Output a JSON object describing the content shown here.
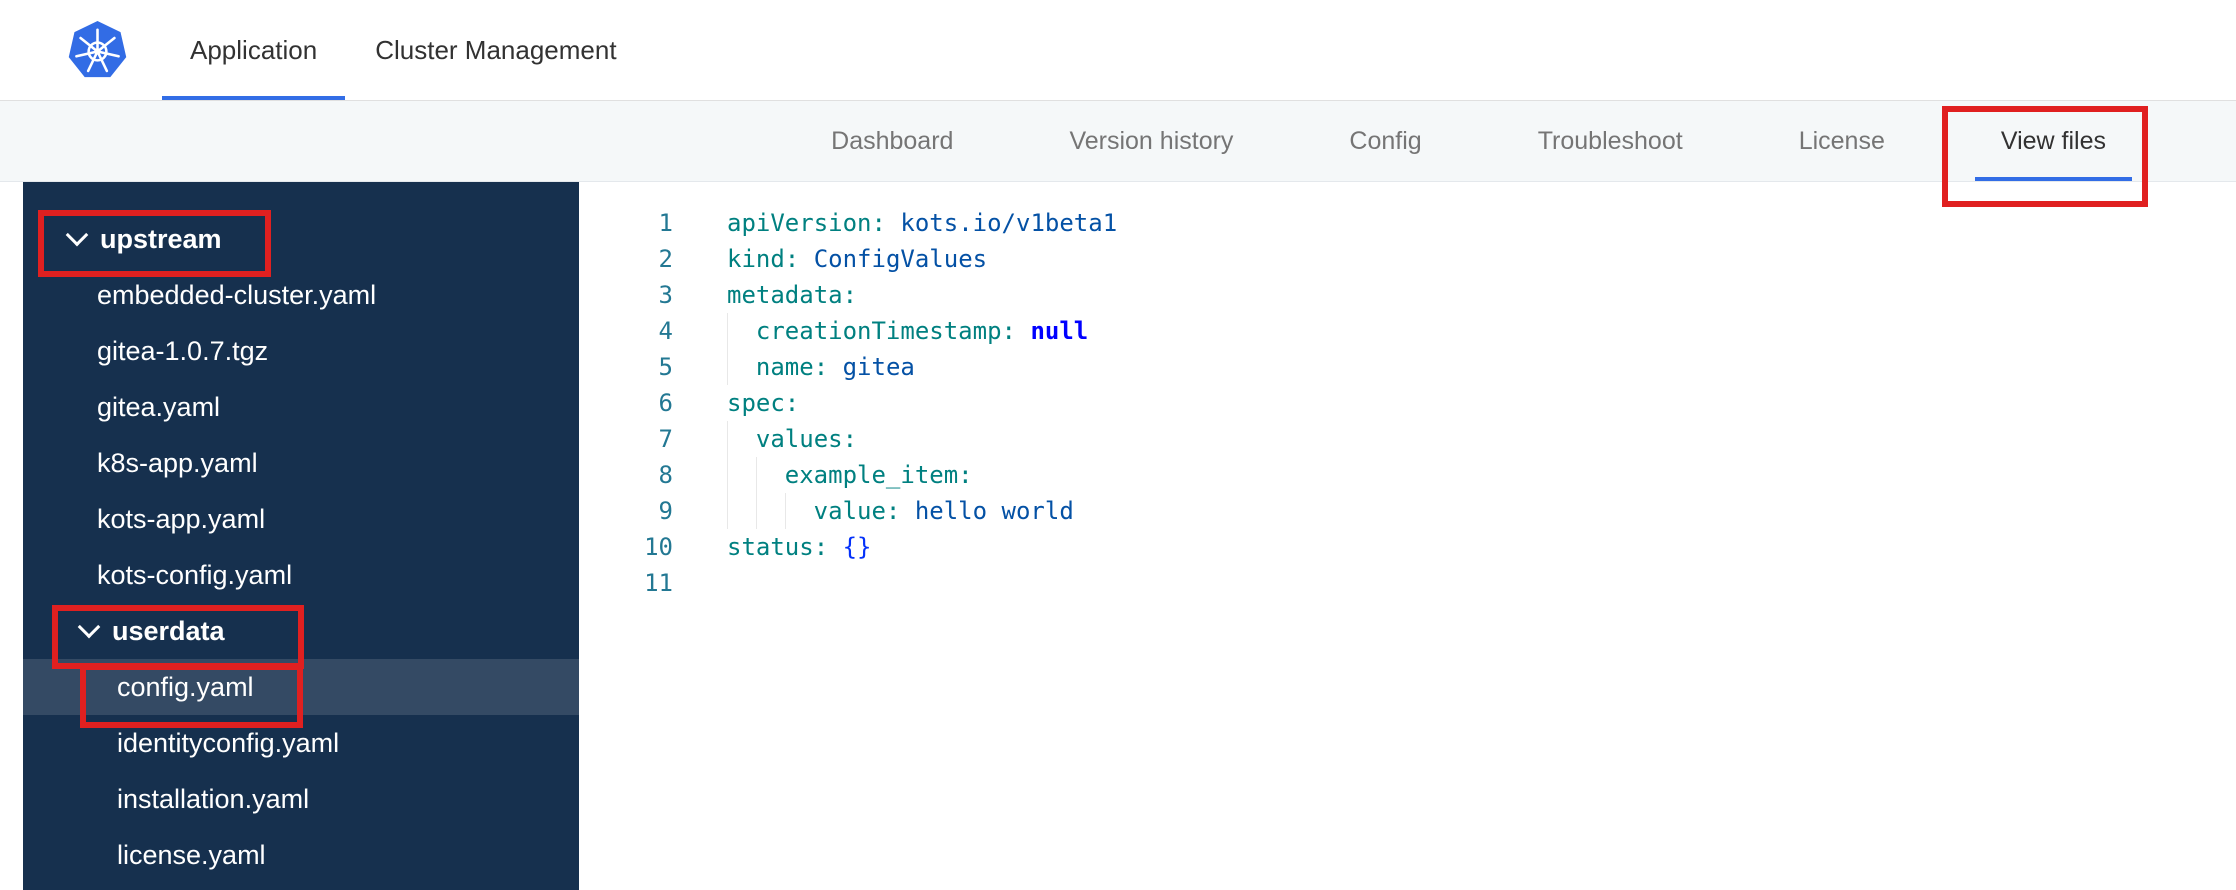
{
  "header": {
    "logo": "kubernetes-logo",
    "accent_color": "#326de6",
    "tabs": [
      {
        "label": "Application",
        "active": true
      },
      {
        "label": "Cluster Management",
        "active": false
      }
    ]
  },
  "subnav": {
    "background_color": "#f5f8f9",
    "items": [
      {
        "label": "Dashboard",
        "active": false
      },
      {
        "label": "Version history",
        "active": false
      },
      {
        "label": "Config",
        "active": false
      },
      {
        "label": "Troubleshoot",
        "active": false
      },
      {
        "label": "License",
        "active": false
      },
      {
        "label": "View files",
        "active": true,
        "annotated": true
      }
    ]
  },
  "file_tree": {
    "background_color": "#16304e",
    "items": [
      {
        "kind": "folder",
        "label": "upstream",
        "level": 0,
        "expanded": true,
        "annotated": true
      },
      {
        "kind": "file",
        "label": "embedded-cluster.yaml",
        "level": 0
      },
      {
        "kind": "file",
        "label": "gitea-1.0.7.tgz",
        "level": 0
      },
      {
        "kind": "file",
        "label": "gitea.yaml",
        "level": 0
      },
      {
        "kind": "file",
        "label": "k8s-app.yaml",
        "level": 0
      },
      {
        "kind": "file",
        "label": "kots-app.yaml",
        "level": 0
      },
      {
        "kind": "file",
        "label": "kots-config.yaml",
        "level": 0
      },
      {
        "kind": "folder",
        "label": "userdata",
        "level": 1,
        "expanded": true,
        "annotated": true
      },
      {
        "kind": "file",
        "label": "config.yaml",
        "level": 2,
        "selected": true,
        "annotated": true
      },
      {
        "kind": "file",
        "label": "identityconfig.yaml",
        "level": 2
      },
      {
        "kind": "file",
        "label": "installation.yaml",
        "level": 2
      },
      {
        "kind": "file",
        "label": "license.yaml",
        "level": 2
      }
    ]
  },
  "editor": {
    "language": "yaml",
    "colors": {
      "key": "#008080",
      "value": "#0451a5",
      "keyword": "#0000ff",
      "bracket": "#0431fa",
      "line_number": "#237893"
    },
    "lines": [
      {
        "num": "1",
        "indent": 0,
        "tokens": [
          {
            "type": "key",
            "text": "apiVersion:"
          },
          {
            "type": "plain",
            "text": " "
          },
          {
            "type": "value",
            "text": "kots.io/v1beta1"
          }
        ]
      },
      {
        "num": "2",
        "indent": 0,
        "tokens": [
          {
            "type": "key",
            "text": "kind:"
          },
          {
            "type": "plain",
            "text": " "
          },
          {
            "type": "value",
            "text": "ConfigValues"
          }
        ]
      },
      {
        "num": "3",
        "indent": 0,
        "tokens": [
          {
            "type": "key",
            "text": "metadata:"
          }
        ]
      },
      {
        "num": "4",
        "indent": 1,
        "tokens": [
          {
            "type": "key",
            "text": "creationTimestamp:"
          },
          {
            "type": "plain",
            "text": " "
          },
          {
            "type": "keyword",
            "text": "null"
          }
        ]
      },
      {
        "num": "5",
        "indent": 1,
        "tokens": [
          {
            "type": "key",
            "text": "name:"
          },
          {
            "type": "plain",
            "text": " "
          },
          {
            "type": "value",
            "text": "gitea"
          }
        ]
      },
      {
        "num": "6",
        "indent": 0,
        "tokens": [
          {
            "type": "key",
            "text": "spec:"
          }
        ]
      },
      {
        "num": "7",
        "indent": 1,
        "tokens": [
          {
            "type": "key",
            "text": "values:"
          }
        ]
      },
      {
        "num": "8",
        "indent": 2,
        "tokens": [
          {
            "type": "key",
            "text": "example_item:"
          }
        ]
      },
      {
        "num": "9",
        "indent": 3,
        "tokens": [
          {
            "type": "key",
            "text": "value:"
          },
          {
            "type": "plain",
            "text": " "
          },
          {
            "type": "value",
            "text": "hello world"
          }
        ]
      },
      {
        "num": "10",
        "indent": 0,
        "tokens": [
          {
            "type": "key",
            "text": "status:"
          },
          {
            "type": "plain",
            "text": " "
          },
          {
            "type": "bracket",
            "text": "{}"
          }
        ]
      },
      {
        "num": "11",
        "indent": 0,
        "tokens": []
      }
    ]
  },
  "annotations": {
    "color": "#e02020",
    "boxes": [
      {
        "target": "view-files-tab"
      },
      {
        "target": "upstream-folder"
      },
      {
        "target": "userdata-folder"
      },
      {
        "target": "config-yaml-file"
      }
    ]
  }
}
